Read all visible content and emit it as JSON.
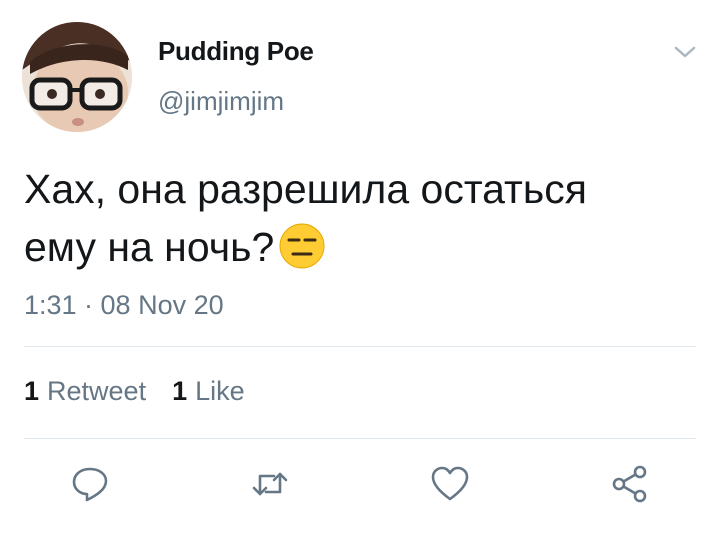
{
  "tweet": {
    "author_name": "Pudding Poe",
    "author_handle": "@jimjimjim",
    "text_line1": "Хах, она разрешила остаться",
    "text_line2": "ему на ночь?",
    "emoji": "expressionless-face",
    "timestamp": "1:31 · 08 Nov 20"
  },
  "stats": {
    "retweets_count": "1",
    "retweets_label": "Retweet",
    "likes_count": "1",
    "likes_label": "Like"
  },
  "actions": [
    "reply-icon",
    "retweet-icon",
    "like-icon",
    "share-icon"
  ],
  "colors": {
    "text": "#14171a",
    "secondary": "#657786",
    "divider": "#e1e8ed"
  }
}
